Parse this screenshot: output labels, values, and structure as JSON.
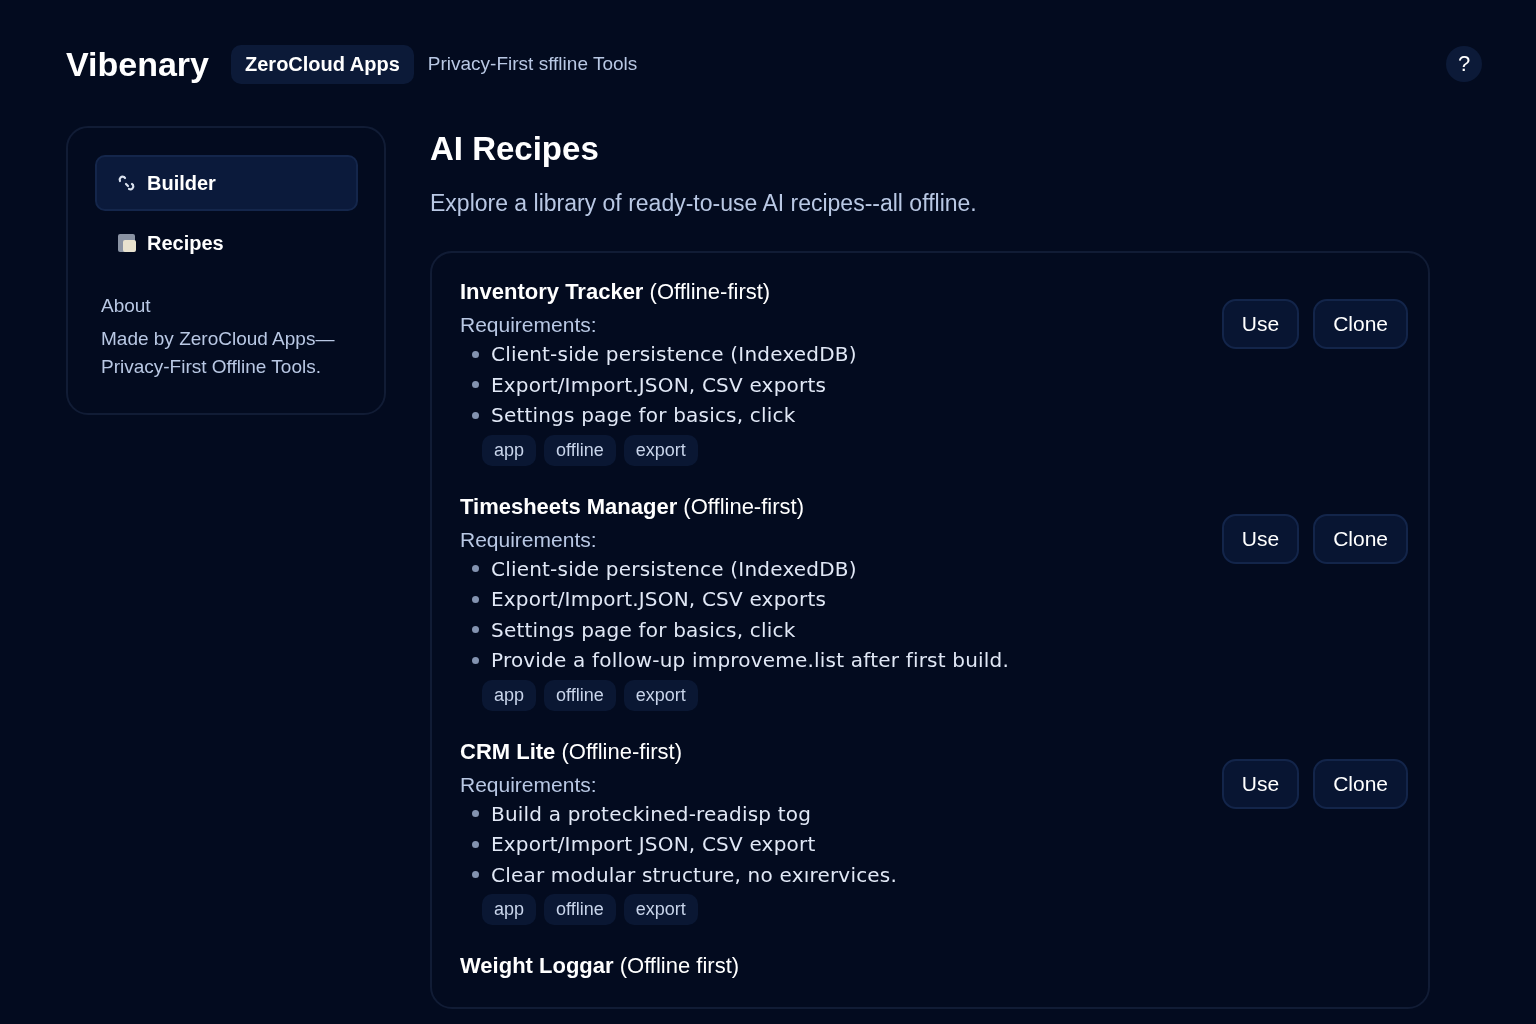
{
  "header": {
    "logo": "Vibenary",
    "badge": "ZeroCloud Apps",
    "tagline": "Privacy-First sffline Tools",
    "help": "?"
  },
  "sidebar": {
    "items": [
      {
        "label": "Builder",
        "selected": true
      },
      {
        "label": "Recipes",
        "selected": false
      }
    ],
    "about_title": "About",
    "about_text": "Made by ZeroCloud Apps—Privacy-First Offline Tools."
  },
  "page": {
    "title": "AI Recipes",
    "subtitle": "Explore a library of ready-to-use AI recipes--all offline."
  },
  "recipes": [
    {
      "title": "**Inventory Tracker** (Offline-first)",
      "requirements_label": "Requirements:",
      "requirements": [
        "Client-side persistence (IndexedDB)",
        "Export/Import.JSON, CSV exports",
        "Settings page for basics, click"
      ],
      "tags": [
        "app",
        "offline",
        "export"
      ],
      "buttons": [
        "Use",
        "Clone"
      ]
    },
    {
      "title": "**Timesheets Manager** (Offline-first)",
      "requirements_label": "Requirements:",
      "requirements": [
        "Client-side persistence (IndexedDB)",
        "Export/Import.JSON, CSV exports",
        "Settings page for basics, click",
        "Provide a follow-up improveme.list after first build."
      ],
      "tags": [
        "app",
        "offline",
        "export"
      ],
      "buttons": [
        "Use",
        "Clone"
      ]
    },
    {
      "title": "**CRM Lite** (Offline-first)",
      "requirements_label": "Requirements:",
      "requirements": [
        "Build a proteckined-readisp tog",
        "Export/Import JSON, CSV export",
        "Clear modular structure, no exırervices."
      ],
      "tags": [
        "app",
        "offline",
        "export"
      ],
      "buttons": [
        "Use",
        "Clone"
      ]
    },
    {
      "title": "**Weight Loggar** (Offline first)"
    }
  ]
}
